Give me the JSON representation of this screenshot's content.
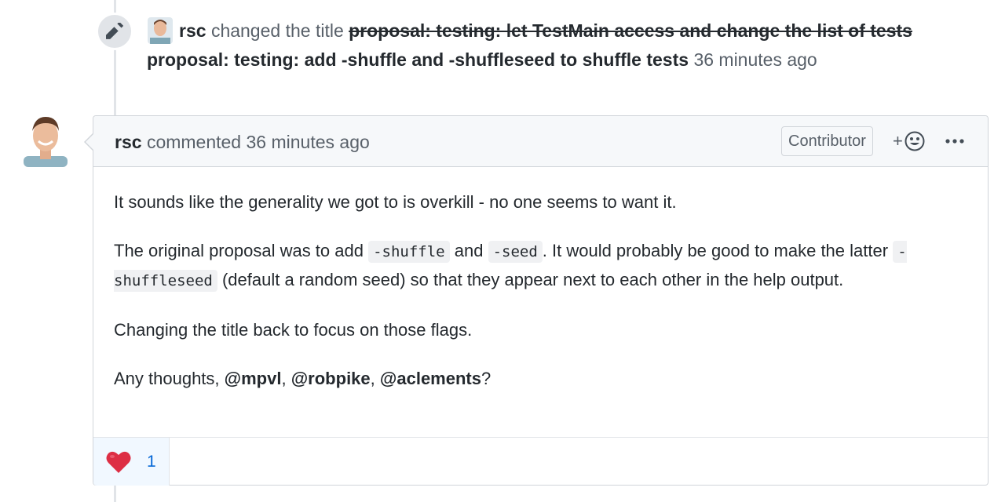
{
  "event": {
    "icon": "pencil-icon",
    "author": "rsc",
    "action": "changed the title",
    "old_title": "proposal: testing: let TestMain access and change the list of tests",
    "new_title": "proposal: testing: add -shuffle and -shuffleseed to shuffle tests",
    "time": "36 minutes ago"
  },
  "comment": {
    "author": "rsc",
    "action": "commented",
    "time": "36 minutes ago",
    "badge": "Contributor",
    "reaction_button": "+",
    "body": {
      "p1": "It sounds like the generality we got to is overkill - no one seems to want it.",
      "p2_a": "The original proposal was to add",
      "p2_code1": "-shuffle",
      "p2_b": "and",
      "p2_code2": "-seed",
      "p2_c": ". It would probably be good to make the latter",
      "p2_code3": "-shuffleseed",
      "p2_d": "(default a random seed) so that they appear next to each other in the help output.",
      "p3": "Changing the title back to focus on those flags.",
      "p4_a": "Any thoughts,",
      "mention1": "@mpvl",
      "sep1": ",",
      "mention2": "@robpike",
      "sep2": ",",
      "mention3": "@aclements",
      "p4_end": "?"
    },
    "reactions": [
      {
        "emoji": "❤️",
        "count": "1"
      }
    ]
  },
  "colors": {
    "link": "#0366d6",
    "border": "#d1d5da",
    "header_bg": "#f6f8fa",
    "reaction_bg": "#f1f8ff"
  }
}
